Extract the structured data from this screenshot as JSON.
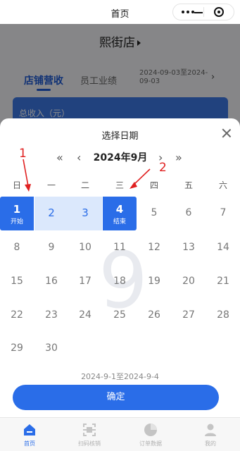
{
  "titlebar": {
    "title": "首页"
  },
  "background": {
    "store_name": "熙街店",
    "tabs": [
      {
        "label": "店铺营收",
        "active": true
      },
      {
        "label": "员工业绩",
        "active": false
      }
    ],
    "date_range": "2024-09-03至2024-09-03",
    "chevron": "›",
    "card_label": "总收入（元）"
  },
  "picker": {
    "title": "选择日期",
    "prev_year": "«",
    "prev_month": "‹",
    "month_label": "2024年9月",
    "next_month": "›",
    "next_year": "»",
    "weekdays": [
      "日",
      "一",
      "二",
      "三",
      "四",
      "五",
      "六"
    ],
    "watermark": "9",
    "days": [
      "1",
      "2",
      "3",
      "4",
      "5",
      "6",
      "7",
      "8",
      "9",
      "10",
      "11",
      "12",
      "13",
      "14",
      "15",
      "16",
      "17",
      "18",
      "19",
      "20",
      "21",
      "22",
      "23",
      "24",
      "25",
      "26",
      "27",
      "28",
      "29",
      "30"
    ],
    "start_label": "开始",
    "end_label": "结束",
    "range_text": "2024-9-1至2024-9-4",
    "confirm_label": "确定"
  },
  "tabbar": [
    {
      "label": "首页",
      "icon": "home-icon",
      "active": true
    },
    {
      "label": "扫码核销",
      "icon": "scan-icon",
      "active": false
    },
    {
      "label": "订单数据",
      "icon": "pie-chart-icon",
      "active": false
    },
    {
      "label": "我的",
      "icon": "user-icon",
      "active": false
    }
  ],
  "annotations": [
    "1",
    "2"
  ],
  "colors": {
    "accent": "#2a6de8",
    "range_fill": "#dbe8fc",
    "annotation": "#e02020"
  }
}
